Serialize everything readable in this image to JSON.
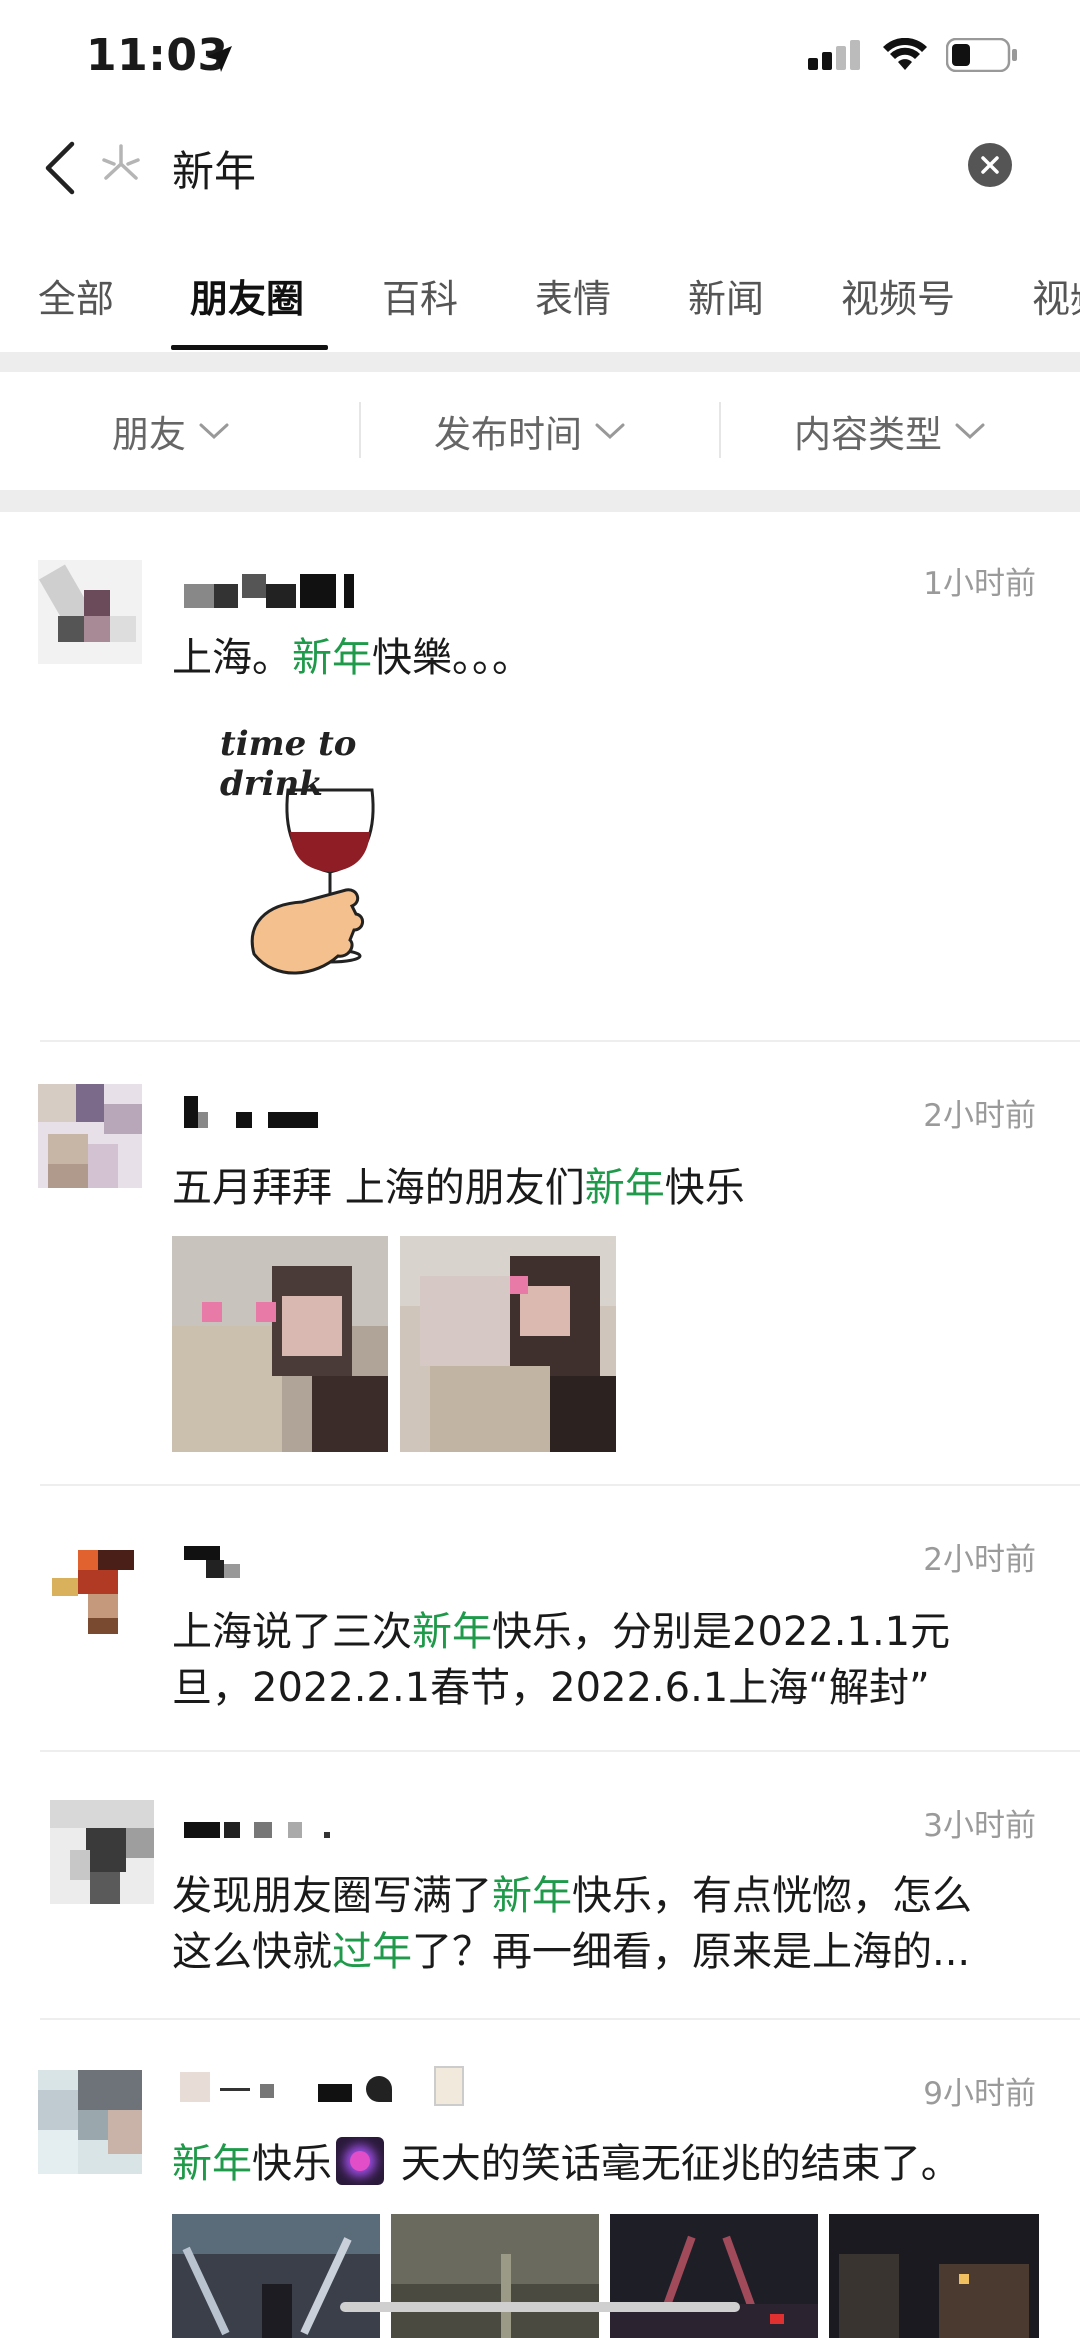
{
  "status": {
    "time": "11:03"
  },
  "search": {
    "query": "新年"
  },
  "tabs": [
    {
      "label": "全部"
    },
    {
      "label": "朋友圈"
    },
    {
      "label": "百科"
    },
    {
      "label": "表情"
    },
    {
      "label": "新闻"
    },
    {
      "label": "视频号"
    },
    {
      "label": "视频"
    }
  ],
  "filters": [
    {
      "label": "朋友"
    },
    {
      "label": "发布时间"
    },
    {
      "label": "内容类型"
    }
  ],
  "posts": [
    {
      "time": "1小时前",
      "text_pre": "上海。",
      "text_hl": "新年",
      "text_post": "快樂。。。",
      "image_caption": "time to drink"
    },
    {
      "time": "2小时前",
      "text_pre": "五月拜拜 上海的朋友们",
      "text_hl": "新年",
      "text_post": "快乐"
    },
    {
      "time": "2小时前",
      "line1_pre": "上海说了三次",
      "line1_hl": "新年",
      "line1_post": "快乐，分别是2022.1.1元",
      "line2": "旦，2022.2.1春节，2022.6.1上海“解封”"
    },
    {
      "time": "3小时前",
      "line1_pre": "发现朋友圈写满了",
      "line1_hl": "新年",
      "line1_post": "快乐，有点恍惚，怎么",
      "line2_pre": "这么快就",
      "line2_hl": "过年",
      "line2_post": "了？再一细看，原来是上海的..."
    },
    {
      "time": "9小时前",
      "text_hl": "新年",
      "text_mid": "快乐",
      "text_post": " 天大的笑话毫无征兆的结束了。"
    }
  ]
}
